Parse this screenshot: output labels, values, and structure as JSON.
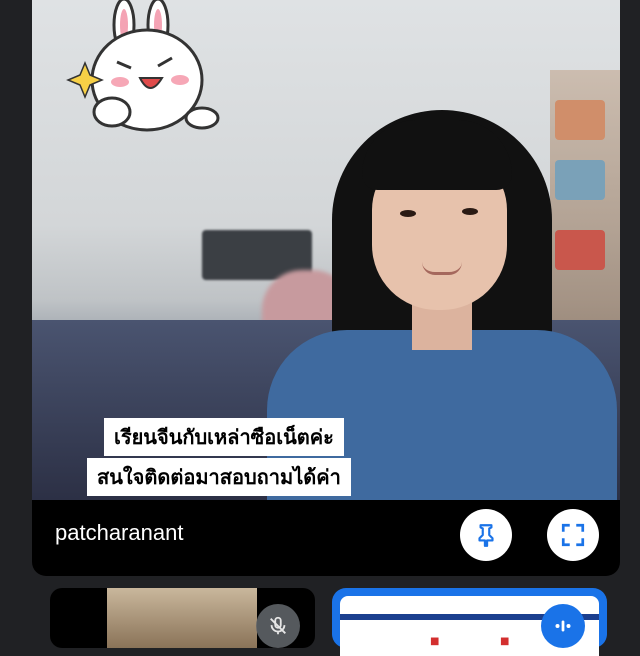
{
  "main_tile": {
    "participant_name": "patcharanant",
    "caption_line_1": "เรียนจีนกับเหล่าซือเน็ตค่ะ",
    "caption_line_2": "สนใจติดต่อมาสอบถามได้ค่า"
  },
  "controls": {
    "pin_icon": "pin-icon",
    "fullscreen_icon": "fullscreen-icon",
    "mic_off_icon": "mic-off-icon",
    "speaking_icon": "speaking-indicator-icon"
  },
  "colors": {
    "tile_bg": "#000000",
    "page_bg": "#202124",
    "active_speaker_border": "#1a73e8"
  }
}
